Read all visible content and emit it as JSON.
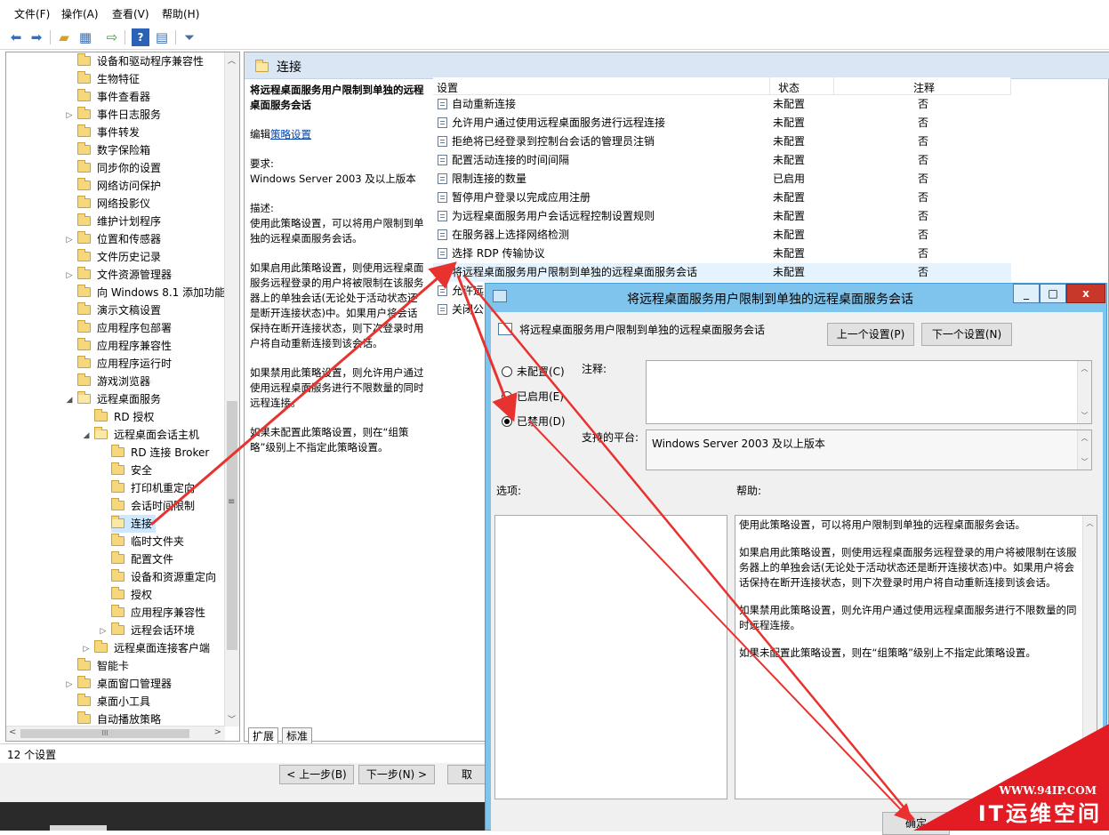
{
  "menu": [
    "文件(F)",
    "操作(A)",
    "查看(V)",
    "帮助(H)"
  ],
  "toolbar_icons": [
    "back-arrow-icon",
    "forward-arrow-icon",
    "up-folder-icon",
    "show-tree-icon",
    "export-icon",
    "help-icon",
    "properties-icon",
    "filter-icon"
  ],
  "tree": {
    "items": [
      {
        "label": "设备和驱动程序兼容性"
      },
      {
        "label": "生物特征"
      },
      {
        "label": "事件查看器"
      },
      {
        "label": "事件日志服务"
      },
      {
        "label": "事件转发"
      },
      {
        "label": "数字保险箱"
      },
      {
        "label": "同步你的设置"
      },
      {
        "label": "网络访问保护"
      },
      {
        "label": "网络投影仪"
      },
      {
        "label": "维护计划程序"
      },
      {
        "label": "位置和传感器"
      },
      {
        "label": "文件历史记录"
      },
      {
        "label": "文件资源管理器"
      },
      {
        "label": "向 Windows 8.1 添加功能"
      },
      {
        "label": "演示文稿设置"
      },
      {
        "label": "应用程序包部署"
      },
      {
        "label": "应用程序兼容性"
      },
      {
        "label": "应用程序运行时"
      },
      {
        "label": "游戏浏览器"
      },
      {
        "label": "远程桌面服务"
      },
      {
        "label": "RD 授权"
      },
      {
        "label": "远程桌面会话主机"
      },
      {
        "label": "RD 连接 Broker"
      },
      {
        "label": "安全"
      },
      {
        "label": "打印机重定向"
      },
      {
        "label": "会话时间限制"
      },
      {
        "label": "连接"
      },
      {
        "label": "临时文件夹"
      },
      {
        "label": "配置文件"
      },
      {
        "label": "设备和资源重定向"
      },
      {
        "label": "授权"
      },
      {
        "label": "应用程序兼容性"
      },
      {
        "label": "远程会话环境"
      },
      {
        "label": "远程桌面连接客户端"
      },
      {
        "label": "智能卡"
      },
      {
        "label": "桌面窗口管理器"
      },
      {
        "label": "桌面小工具"
      },
      {
        "label": "自动播放策略"
      }
    ],
    "hscroll_thumb": "III"
  },
  "right": {
    "title": "连接",
    "desc": {
      "policy_title": "将远程桌面服务用户限制到单独的远程桌面服务会话",
      "edit_prefix": "编辑",
      "edit_link": "策略设置",
      "req_label": "要求:",
      "req_value": "Windows Server 2003 及以上版本",
      "desc_label": "描述:",
      "desc_text": "使用此策略设置，可以将用户限制到单独的远程桌面服务会话。",
      "p_enabled": "如果启用此策略设置，则使用远程桌面服务远程登录的用户将被限制在该服务器上的单独会话(无论处于活动状态还是断开连接状态)中。如果用户将会话保持在断开连接状态，则下次登录时用户将自动重新连接到该会话。",
      "p_disabled": "如果禁用此策略设置，则允许用户通过使用远程桌面服务进行不限数量的同时远程连接。",
      "p_notconfig": "如果未配置此策略设置，则在“组策略”级别上不指定此策略设置。"
    },
    "columns": {
      "setting": "设置",
      "state": "状态",
      "comment": "注释"
    },
    "rows": [
      {
        "name": "自动重新连接",
        "state": "未配置",
        "comment": "否"
      },
      {
        "name": "允许用户通过使用远程桌面服务进行远程连接",
        "state": "未配置",
        "comment": "否"
      },
      {
        "name": "拒绝将已经登录到控制台会话的管理员注销",
        "state": "未配置",
        "comment": "否"
      },
      {
        "name": "配置活动连接的时间间隔",
        "state": "未配置",
        "comment": "否"
      },
      {
        "name": "限制连接的数量",
        "state": "已启用",
        "comment": "否"
      },
      {
        "name": "暂停用户登录以完成应用注册",
        "state": "未配置",
        "comment": "否"
      },
      {
        "name": "为远程桌面服务用户会话远程控制设置规则",
        "state": "未配置",
        "comment": "否"
      },
      {
        "name": "在服务器上选择网络检测",
        "state": "未配置",
        "comment": "否"
      },
      {
        "name": "选择 RDP 传输协议",
        "state": "未配置",
        "comment": "否"
      },
      {
        "name": "将远程桌面服务用户限制到单独的远程桌面服务会话",
        "state": "未配置",
        "comment": "否"
      },
      {
        "name": "允许远",
        "state": "",
        "comment": ""
      },
      {
        "name": "关闭公",
        "state": "",
        "comment": ""
      }
    ],
    "tabs": [
      "扩展",
      "标准"
    ]
  },
  "status": "12 个设置",
  "wizard": {
    "prev": "< 上一步(B)",
    "next": "下一步(N) >",
    "cancel": "取"
  },
  "dialog": {
    "title": "将远程桌面服务用户限制到单独的远程桌面服务会话",
    "caption": {
      "min": "_",
      "max": "□",
      "close": "x"
    },
    "header": "将远程桌面服务用户限制到单独的远程桌面服务会话",
    "prev_btn": "上一个设置(P)",
    "next_btn": "下一个设置(N)",
    "radios": {
      "notconfig": "未配置(C)",
      "enabled": "已启用(E)",
      "disabled": "已禁用(D)"
    },
    "selected": "disabled",
    "comment_label": "注释:",
    "platform_label": "支持的平台:",
    "platform_value": "Windows Server 2003 及以上版本",
    "options_label": "选项:",
    "help_label": "帮助:",
    "help": {
      "p1": "使用此策略设置，可以将用户限制到单独的远程桌面服务会话。",
      "p2": "如果启用此策略设置，则使用远程桌面服务远程登录的用户将被限制在该服务器上的单独会话(无论处于活动状态还是断开连接状态)中。如果用户将会话保持在断开连接状态，则下次登录时用户将自动重新连接到该会话。",
      "p3": "如果禁用此策略设置，则允许用户通过使用远程桌面服务进行不限数量的同时远程连接。",
      "p4": "如果未配置此策略设置，则在“组策略”级别上不指定此策略设置。"
    },
    "ok_btn": "确定"
  },
  "watermark": {
    "url": "WWW.94IP.COM",
    "name": "IT运维空间"
  },
  "colors": {
    "arrow": "#e8322f",
    "dialog_frame": "#7ec4ec",
    "header": "#dbe6f4",
    "watermark": "#e31b23"
  }
}
